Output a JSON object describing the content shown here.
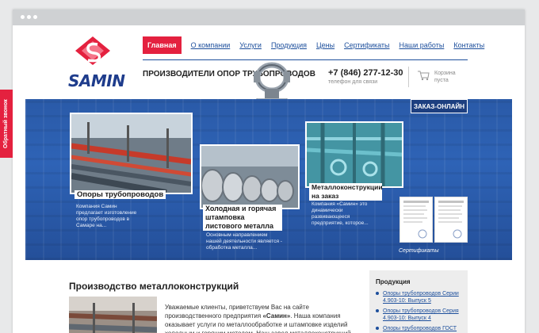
{
  "logo": {
    "text": "SAMIN"
  },
  "nav": {
    "items": [
      "Главная",
      "О компании",
      "Услуги",
      "Продукция",
      "Цены",
      "Сертификаты",
      "Наши работы",
      "Контакты"
    ]
  },
  "header": {
    "tagline": "Производители опор трубопроводов",
    "phone": "+7 (846) 277-12-30",
    "phone_caption": "телефон для связи",
    "cart_label": "Корзина пуста"
  },
  "callback": "Обратный звонок",
  "order_online": "ЗАКАЗ-ОНЛАЙН",
  "cards": [
    {
      "title": "Опоры трубопроводов",
      "desc": "Компания Самин предлагает изготовление опор трубопроводов в Самаре на..."
    },
    {
      "title": "Холодная и горячая штамповка листового металла",
      "desc": "Основным направлением нашей деятельности является - обработка металла..."
    },
    {
      "title": "Металлоконструкции на заказ",
      "desc": "Компания «Самин» это динамически развивающееся предприятие, которое..."
    }
  ],
  "certificates_label": "Сертификаты",
  "content": {
    "heading": "Производство металлоконструкций",
    "intro_pre": "Уважаемые клиенты, приветствуем Вас на сайте производственного предприятия ",
    "intro_bold": "«Самин»",
    "intro_post": ". Наша компания оказывает услуги по металлообработке и штамповке изделий холодным и горячим методом. Наш завод металлоконструкций в Самаре производит про-"
  },
  "sidebar": {
    "title": "Продукция",
    "items": [
      "Опоры трубопроводов Серии 4.903-10: Выпуск 5",
      "Опоры трубопроводов Серия 4.903-10: Выпуск 4",
      "Опоры трубопроводов ГОСТ"
    ]
  },
  "colors": {
    "accent": "#e4213f",
    "brand": "#1d4f9c",
    "banner": "#2e63b6"
  },
  "icons": {
    "cart": "cart-icon",
    "logo": "samin-logo-icon"
  }
}
